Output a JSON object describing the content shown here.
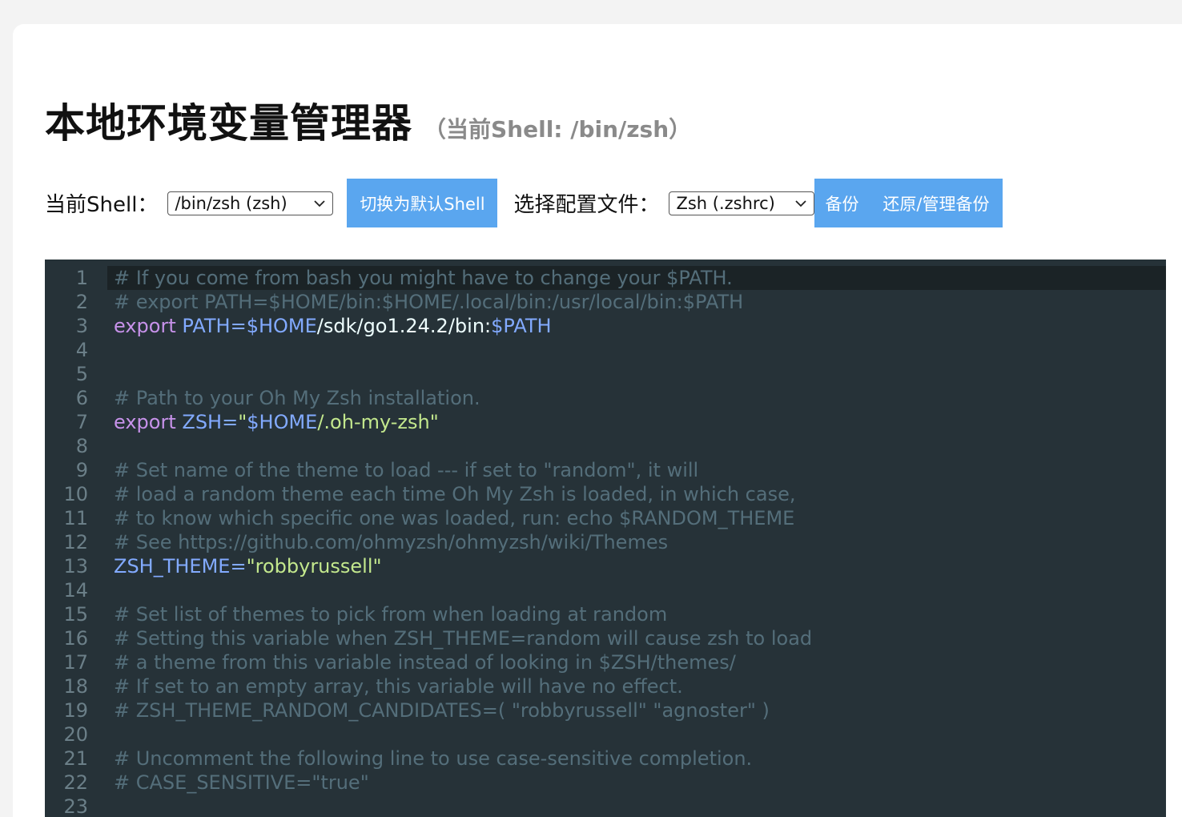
{
  "header": {
    "title": "本地环境变量管理器",
    "subtitle": "（当前Shell: /bin/zsh）"
  },
  "toolbar": {
    "shell_label": "当前Shell：",
    "shell_select_value": "/bin/zsh (zsh)",
    "set_default_button": "切换为默认Shell",
    "config_label": "选择配置文件：",
    "config_select_value": "Zsh (.zshrc)",
    "backup_button": "备份",
    "restore_button": "还原/管理备份"
  },
  "colors": {
    "button_bg": "#5aa6ef",
    "editor_bg": "#263238",
    "comment": "#546e7a",
    "keyword": "#c792ea",
    "variable": "#82aaff",
    "string": "#c3e88d"
  },
  "editor": {
    "lines": [
      {
        "num": "1",
        "c1": "# If you come from bash you might have to change your $PATH."
      },
      {
        "num": "2",
        "c1": "# export PATH=$HOME/bin:$HOME/.local/bin:/usr/local/bin:$PATH"
      },
      {
        "num": "3",
        "k1": "export",
        "v1": " PATH=$HOME",
        "t1": "/sdk/go1.24.2/bin:",
        "v2": "$PATH"
      },
      {
        "num": "4"
      },
      {
        "num": "5"
      },
      {
        "num": "6",
        "c1": "# Path to your Oh My Zsh installation."
      },
      {
        "num": "7",
        "k1": "export",
        "v1": " ZSH=",
        "s1": "\"",
        "v2": "$HOME",
        "s2": "/.oh-my-zsh\""
      },
      {
        "num": "8"
      },
      {
        "num": "9",
        "c1": "# Set name of the theme to load --- if set to \"random\", it will"
      },
      {
        "num": "10",
        "c1": "# load a random theme each time Oh My Zsh is loaded, in which case,"
      },
      {
        "num": "11",
        "c1": "# to know which specific one was loaded, run: echo $RANDOM_THEME"
      },
      {
        "num": "12",
        "c1": "# See https://github.com/ohmyzsh/ohmyzsh/wiki/Themes"
      },
      {
        "num": "13",
        "v1": "ZSH_THEME=",
        "s1": "\"robbyrussell\""
      },
      {
        "num": "14"
      },
      {
        "num": "15",
        "c1": "# Set list of themes to pick from when loading at random"
      },
      {
        "num": "16",
        "c1": "# Setting this variable when ZSH_THEME=random will cause zsh to load"
      },
      {
        "num": "17",
        "c1": "# a theme from this variable instead of looking in $ZSH/themes/"
      },
      {
        "num": "18",
        "c1": "# If set to an empty array, this variable will have no effect."
      },
      {
        "num": "19",
        "c1": "# ZSH_THEME_RANDOM_CANDIDATES=( \"robbyrussell\" \"agnoster\" )"
      },
      {
        "num": "20"
      },
      {
        "num": "21",
        "c1": "# Uncomment the following line to use case-sensitive completion."
      },
      {
        "num": "22",
        "c1": "# CASE_SENSITIVE=\"true\""
      },
      {
        "num": "23"
      }
    ]
  }
}
